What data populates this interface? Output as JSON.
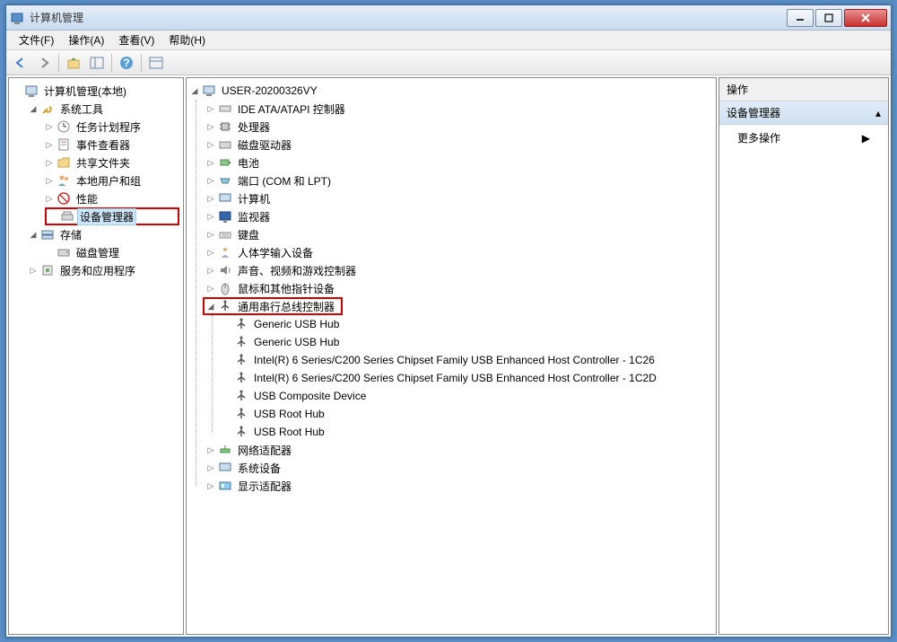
{
  "window": {
    "title": "计算机管理"
  },
  "menu": {
    "file": "文件(F)",
    "action": "操作(A)",
    "view": "查看(V)",
    "help": "帮助(H)"
  },
  "left_tree": {
    "root": "计算机管理(本地)",
    "system_tools": "系统工具",
    "task_scheduler": "任务计划程序",
    "event_viewer": "事件查看器",
    "shared_folders": "共享文件夹",
    "local_users": "本地用户和组",
    "performance": "性能",
    "device_manager": "设备管理器",
    "storage": "存储",
    "disk_mgmt": "磁盘管理",
    "services": "服务和应用程序"
  },
  "center_tree": {
    "root": "USER-20200326VY",
    "ide": "IDE ATA/ATAPI 控制器",
    "cpu": "处理器",
    "disk_drives": "磁盘驱动器",
    "battery": "电池",
    "ports": "端口 (COM 和 LPT)",
    "computer": "计算机",
    "monitor": "监视器",
    "keyboard": "键盘",
    "hid": "人体学输入设备",
    "sound": "声音、视频和游戏控制器",
    "mouse": "鼠标和其他指针设备",
    "usb_ctrl": "通用串行总线控制器",
    "usb_items": [
      "Generic USB Hub",
      "Generic USB Hub",
      "Intel(R) 6 Series/C200 Series Chipset Family USB Enhanced Host Controller - 1C26",
      "Intel(R) 6 Series/C200 Series Chipset Family USB Enhanced Host Controller - 1C2D",
      "USB Composite Device",
      "USB Root Hub",
      "USB Root Hub"
    ],
    "network": "网络适配器",
    "system_dev": "系统设备",
    "display": "显示适配器"
  },
  "right": {
    "header": "操作",
    "section": "设备管理器",
    "more": "更多操作"
  }
}
